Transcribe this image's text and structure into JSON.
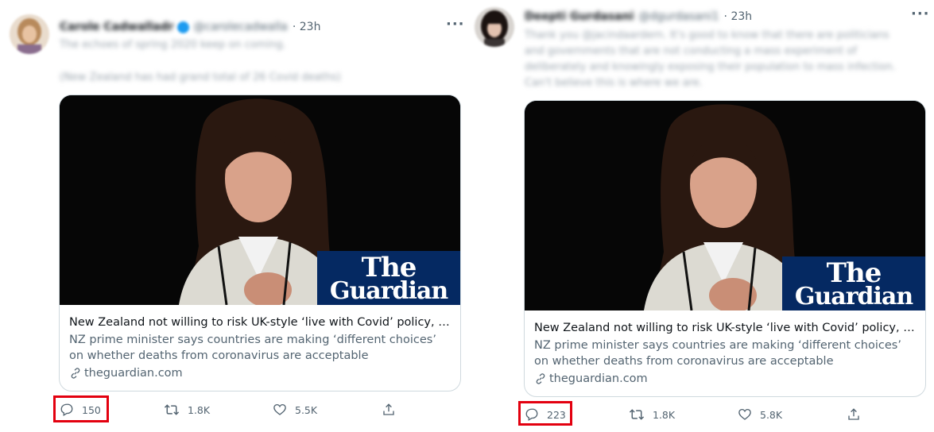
{
  "tweets": [
    {
      "author_name": "Carole Cadwalladr",
      "author_handle": "@carolecadwalla",
      "verified": true,
      "time": "· 23h",
      "text_lines": [
        "The echoes of spring 2020 keep on coming.",
        "(New Zealand has had grand total of 26 Covid deaths)"
      ],
      "card": {
        "brand_line1": "The",
        "brand_line2": "Guardian",
        "title": "New Zealand not willing to risk UK-style ‘live with Covid’ policy, say...",
        "description": "NZ prime minister says countries are making ‘different choices’ on whether deaths from coronavirus are acceptable",
        "domain": "theguardian.com"
      },
      "actions": {
        "replies": "150",
        "retweets": "1.8K",
        "likes": "5.5K"
      },
      "highlighted": "replies"
    },
    {
      "author_name": "Deepti Gurdasani",
      "author_handle": "@dgurdasani1",
      "verified": false,
      "time": "· 23h",
      "text_lines": [
        "Thank you @jacindaardern. It's good to know that there are politicians",
        "and governments that are not conducting a mass experiment of",
        "deliberately and knowingly exposing their population to mass infection.",
        "Can't believe this is where we are."
      ],
      "card": {
        "brand_line1": "The",
        "brand_line2": "Guardian",
        "title": "New Zealand not willing to risk UK-style ‘live with Covid’ policy, say...",
        "description": "NZ prime minister says countries are making ‘different choices’ on whether deaths from coronavirus are acceptable",
        "domain": "theguardian.com"
      },
      "actions": {
        "replies": "223",
        "retweets": "1.8K",
        "likes": "5.8K"
      },
      "highlighted": "replies"
    }
  ],
  "icons": {
    "reply": "reply-icon",
    "retweet": "retweet-icon",
    "like": "heart-icon",
    "share": "share-icon",
    "link": "link-icon",
    "more": "more-icon",
    "verified": "verified-badge-icon"
  },
  "colors": {
    "accent": "#1d9bf0",
    "highlight_box": "#e3000f",
    "guardian_blue": "#052962",
    "secondary_text": "#536471"
  }
}
